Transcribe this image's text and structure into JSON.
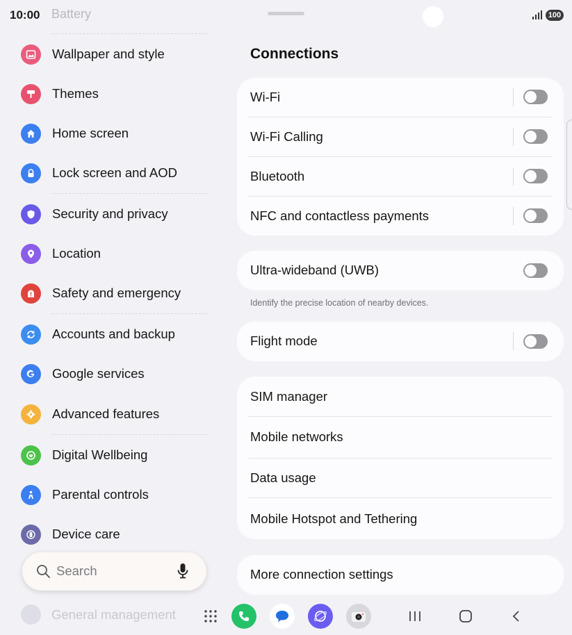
{
  "status": {
    "time": "10:00",
    "battery": "100"
  },
  "sidebar": {
    "top_cut_label": "Battery",
    "items": [
      {
        "label": "Wallpaper and style",
        "icon": "wallpaper-icon",
        "color": "#ea5c7c"
      },
      {
        "label": "Themes",
        "icon": "themes-icon",
        "color": "#e8526e"
      },
      {
        "label": "Home screen",
        "icon": "home-icon",
        "color": "#3c7ff0"
      },
      {
        "label": "Lock screen and AOD",
        "icon": "lock-icon",
        "color": "#3c7ff0"
      },
      {
        "label": "Security and privacy",
        "icon": "shield-icon",
        "color": "#6a5ae8"
      },
      {
        "label": "Location",
        "icon": "location-pin-icon",
        "color": "#8a5ee8"
      },
      {
        "label": "Safety and emergency",
        "icon": "alert-icon",
        "color": "#e0443c"
      },
      {
        "label": "Accounts and backup",
        "icon": "sync-icon",
        "color": "#3b8ef0"
      },
      {
        "label": "Google services",
        "icon": "google-icon",
        "color": "#3c7ff0"
      },
      {
        "label": "Advanced features",
        "icon": "gear-icon",
        "color": "#f5b33d"
      },
      {
        "label": "Digital Wellbeing",
        "icon": "wellbeing-icon",
        "color": "#4cc24a"
      },
      {
        "label": "Parental controls",
        "icon": "family-icon",
        "color": "#3c7ff0"
      },
      {
        "label": "Device care",
        "icon": "device-care-icon",
        "color": "#6c6aa8"
      }
    ],
    "bottom_cut_label": "General management"
  },
  "search": {
    "label": "Search"
  },
  "main": {
    "title": "Connections",
    "group1": [
      {
        "label": "Wi-Fi",
        "toggle": false
      },
      {
        "label": "Wi-Fi Calling",
        "toggle": false
      },
      {
        "label": "Bluetooth",
        "toggle": false
      },
      {
        "label": "NFC and contactless payments",
        "toggle": false
      }
    ],
    "uwb": {
      "label": "Ultra-wideband (UWB)",
      "toggle": false,
      "description": "Identify the precise location of nearby devices."
    },
    "flight": {
      "label": "Flight mode",
      "toggle": false
    },
    "group3": [
      {
        "label": "SIM manager"
      },
      {
        "label": "Mobile networks"
      },
      {
        "label": "Data usage"
      },
      {
        "label": "Mobile Hotspot and Tethering"
      }
    ],
    "more": {
      "label": "More connection settings"
    }
  },
  "dock": {
    "apps": [
      {
        "name": "phone-app-icon",
        "color": "#25c26a"
      },
      {
        "name": "messages-app-icon",
        "color": "#ffffff"
      },
      {
        "name": "internet-app-icon",
        "color": "#6b5cf0"
      },
      {
        "name": "camera-app-icon",
        "color": "#d8d8dc"
      }
    ],
    "nav_buttons": [
      "recents-icon",
      "home-button-icon",
      "back-icon"
    ]
  }
}
